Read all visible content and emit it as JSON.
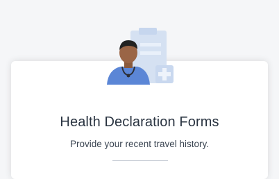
{
  "card": {
    "title": "Health Declaration Forms",
    "subtitle": "Provide your recent travel history.",
    "illustration_icon": "doctor-with-clipboard-icon"
  },
  "colors": {
    "page_bg": "#f5f6f8",
    "card_bg": "#ffffff",
    "title": "#2a3441",
    "accent_blue": "#5b86d6",
    "clipboard": "#d8e3f3"
  }
}
